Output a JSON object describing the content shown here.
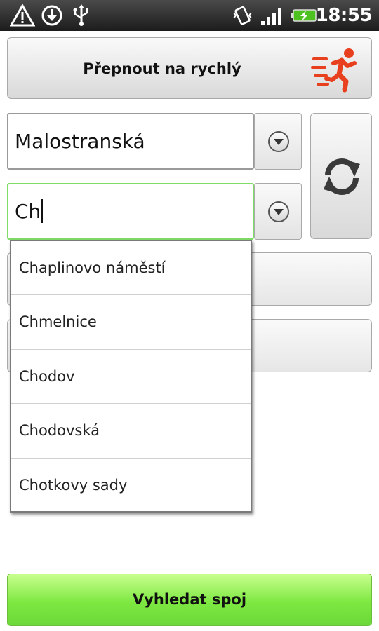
{
  "status_bar": {
    "time": "18:55",
    "icons": [
      "alert-triangle-icon",
      "download-icon",
      "usb-icon",
      "vibrate-icon",
      "signal-icon",
      "battery-charging-icon"
    ]
  },
  "fast_mode_button": {
    "label": "Přepnout na rychlý",
    "icon": "running-man-icon",
    "icon_color": "#e8401f"
  },
  "from_stop": {
    "value": "Malostranská"
  },
  "to_stop": {
    "value": "Ch",
    "focused": true,
    "focus_color": "#7fdc67"
  },
  "swap_button": {
    "icon": "swap-arrows-icon"
  },
  "suggestions": [
    "Chaplinovo náměstí",
    "Chmelnice",
    "Chodov",
    "Chodovská",
    "Chotkovy sady"
  ],
  "search_button": {
    "label": "Vyhledat spoj",
    "color": "#7ee841"
  }
}
